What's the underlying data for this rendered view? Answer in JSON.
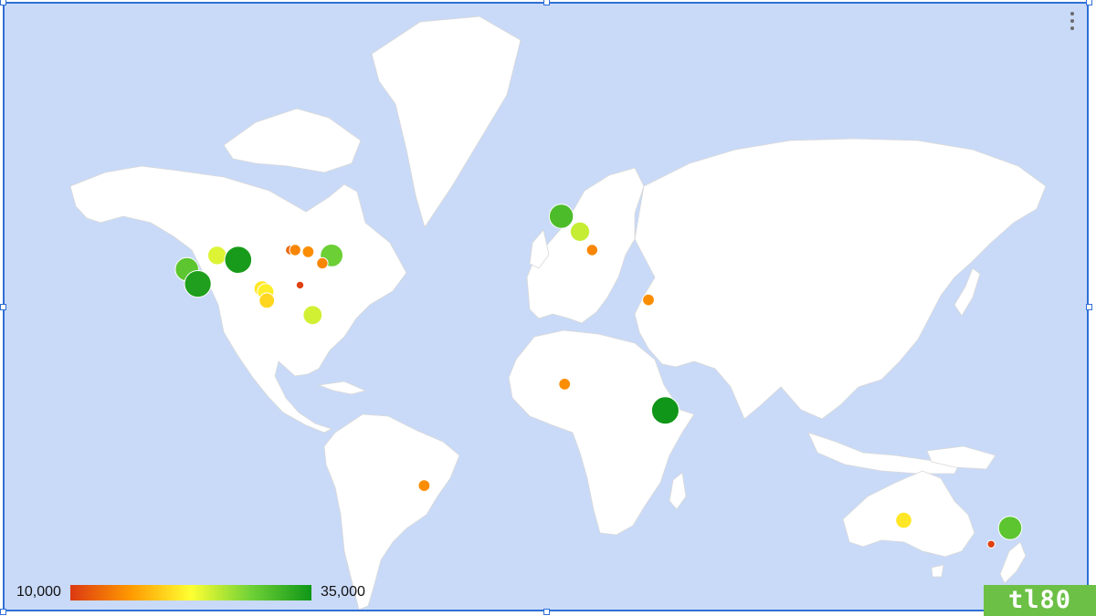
{
  "chart_data": {
    "type": "geo-bubble",
    "color_axis": {
      "min_label": "10,000",
      "max_label": "35,000",
      "min": 10000,
      "max": 35000,
      "colors": [
        "#dc3912",
        "#ff9900",
        "#ffff33",
        "#6fd136",
        "#109618"
      ]
    },
    "points": [
      {
        "lon": -121.9,
        "lat": 37.5,
        "value": 30000
      },
      {
        "lon": -118.3,
        "lat": 34.0,
        "value": 34000
      },
      {
        "lon": -111.9,
        "lat": 40.7,
        "value": 24000
      },
      {
        "lon": -104.9,
        "lat": 39.7,
        "value": 34500
      },
      {
        "lon": -97.0,
        "lat": 32.8,
        "value": 21000
      },
      {
        "lon": -95.8,
        "lat": 32.0,
        "value": 21500
      },
      {
        "lon": -95.4,
        "lat": 29.8,
        "value": 20000
      },
      {
        "lon": -87.6,
        "lat": 41.9,
        "value": 13000
      },
      {
        "lon": -86.0,
        "lat": 41.9,
        "value": 15000
      },
      {
        "lon": -81.7,
        "lat": 41.5,
        "value": 15500
      },
      {
        "lon": -84.4,
        "lat": 33.7,
        "value": 10500
      },
      {
        "lon": -80.2,
        "lat": 26.0,
        "value": 24500
      },
      {
        "lon": -73.9,
        "lat": 40.7,
        "value": 29000
      },
      {
        "lon": -77.0,
        "lat": 38.9,
        "value": 15000
      },
      {
        "lon": 2.3,
        "lat": 48.9,
        "value": 31000
      },
      {
        "lon": 8.5,
        "lat": 45.8,
        "value": 25000
      },
      {
        "lon": 12.5,
        "lat": 41.9,
        "value": 15000
      },
      {
        "lon": 31.2,
        "lat": 30.0,
        "value": 15500
      },
      {
        "lon": 3.4,
        "lat": 6.5,
        "value": 15500
      },
      {
        "lon": 36.8,
        "lat": -1.3,
        "value": 35000
      },
      {
        "lon": -43.2,
        "lat": -22.9,
        "value": 15500
      },
      {
        "lon": 115.9,
        "lat": -32.0,
        "value": 21000
      },
      {
        "lon": 151.2,
        "lat": -33.9,
        "value": 30000
      },
      {
        "lon": 144.9,
        "lat": -37.8,
        "value": 10500
      }
    ]
  },
  "icons": {
    "menu": "more-vert-icon"
  },
  "badge": {
    "text": "tl80"
  }
}
